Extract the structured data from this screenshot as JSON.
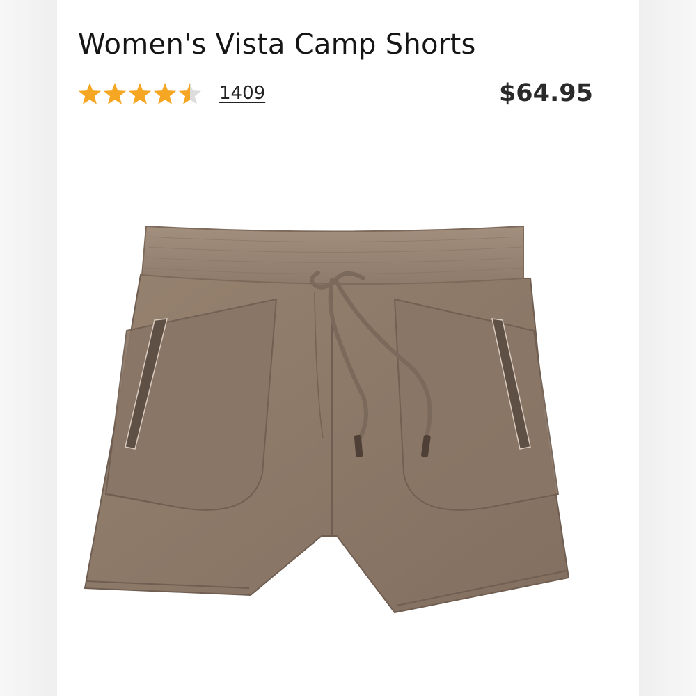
{
  "product": {
    "title": "Women's Vista Camp Shorts",
    "rating": 4.5,
    "rating_max": 5,
    "review_count": "1409",
    "price": "$64.95",
    "image_alt": "shorts-product-photo"
  },
  "colors": {
    "star": "#f5a623",
    "star_empty": "#dddddd",
    "fabric": "#8e7a6a",
    "fabric_dark": "#6f5e51",
    "waistband": "#9a8676"
  },
  "icons": {
    "star": "star-icon"
  }
}
